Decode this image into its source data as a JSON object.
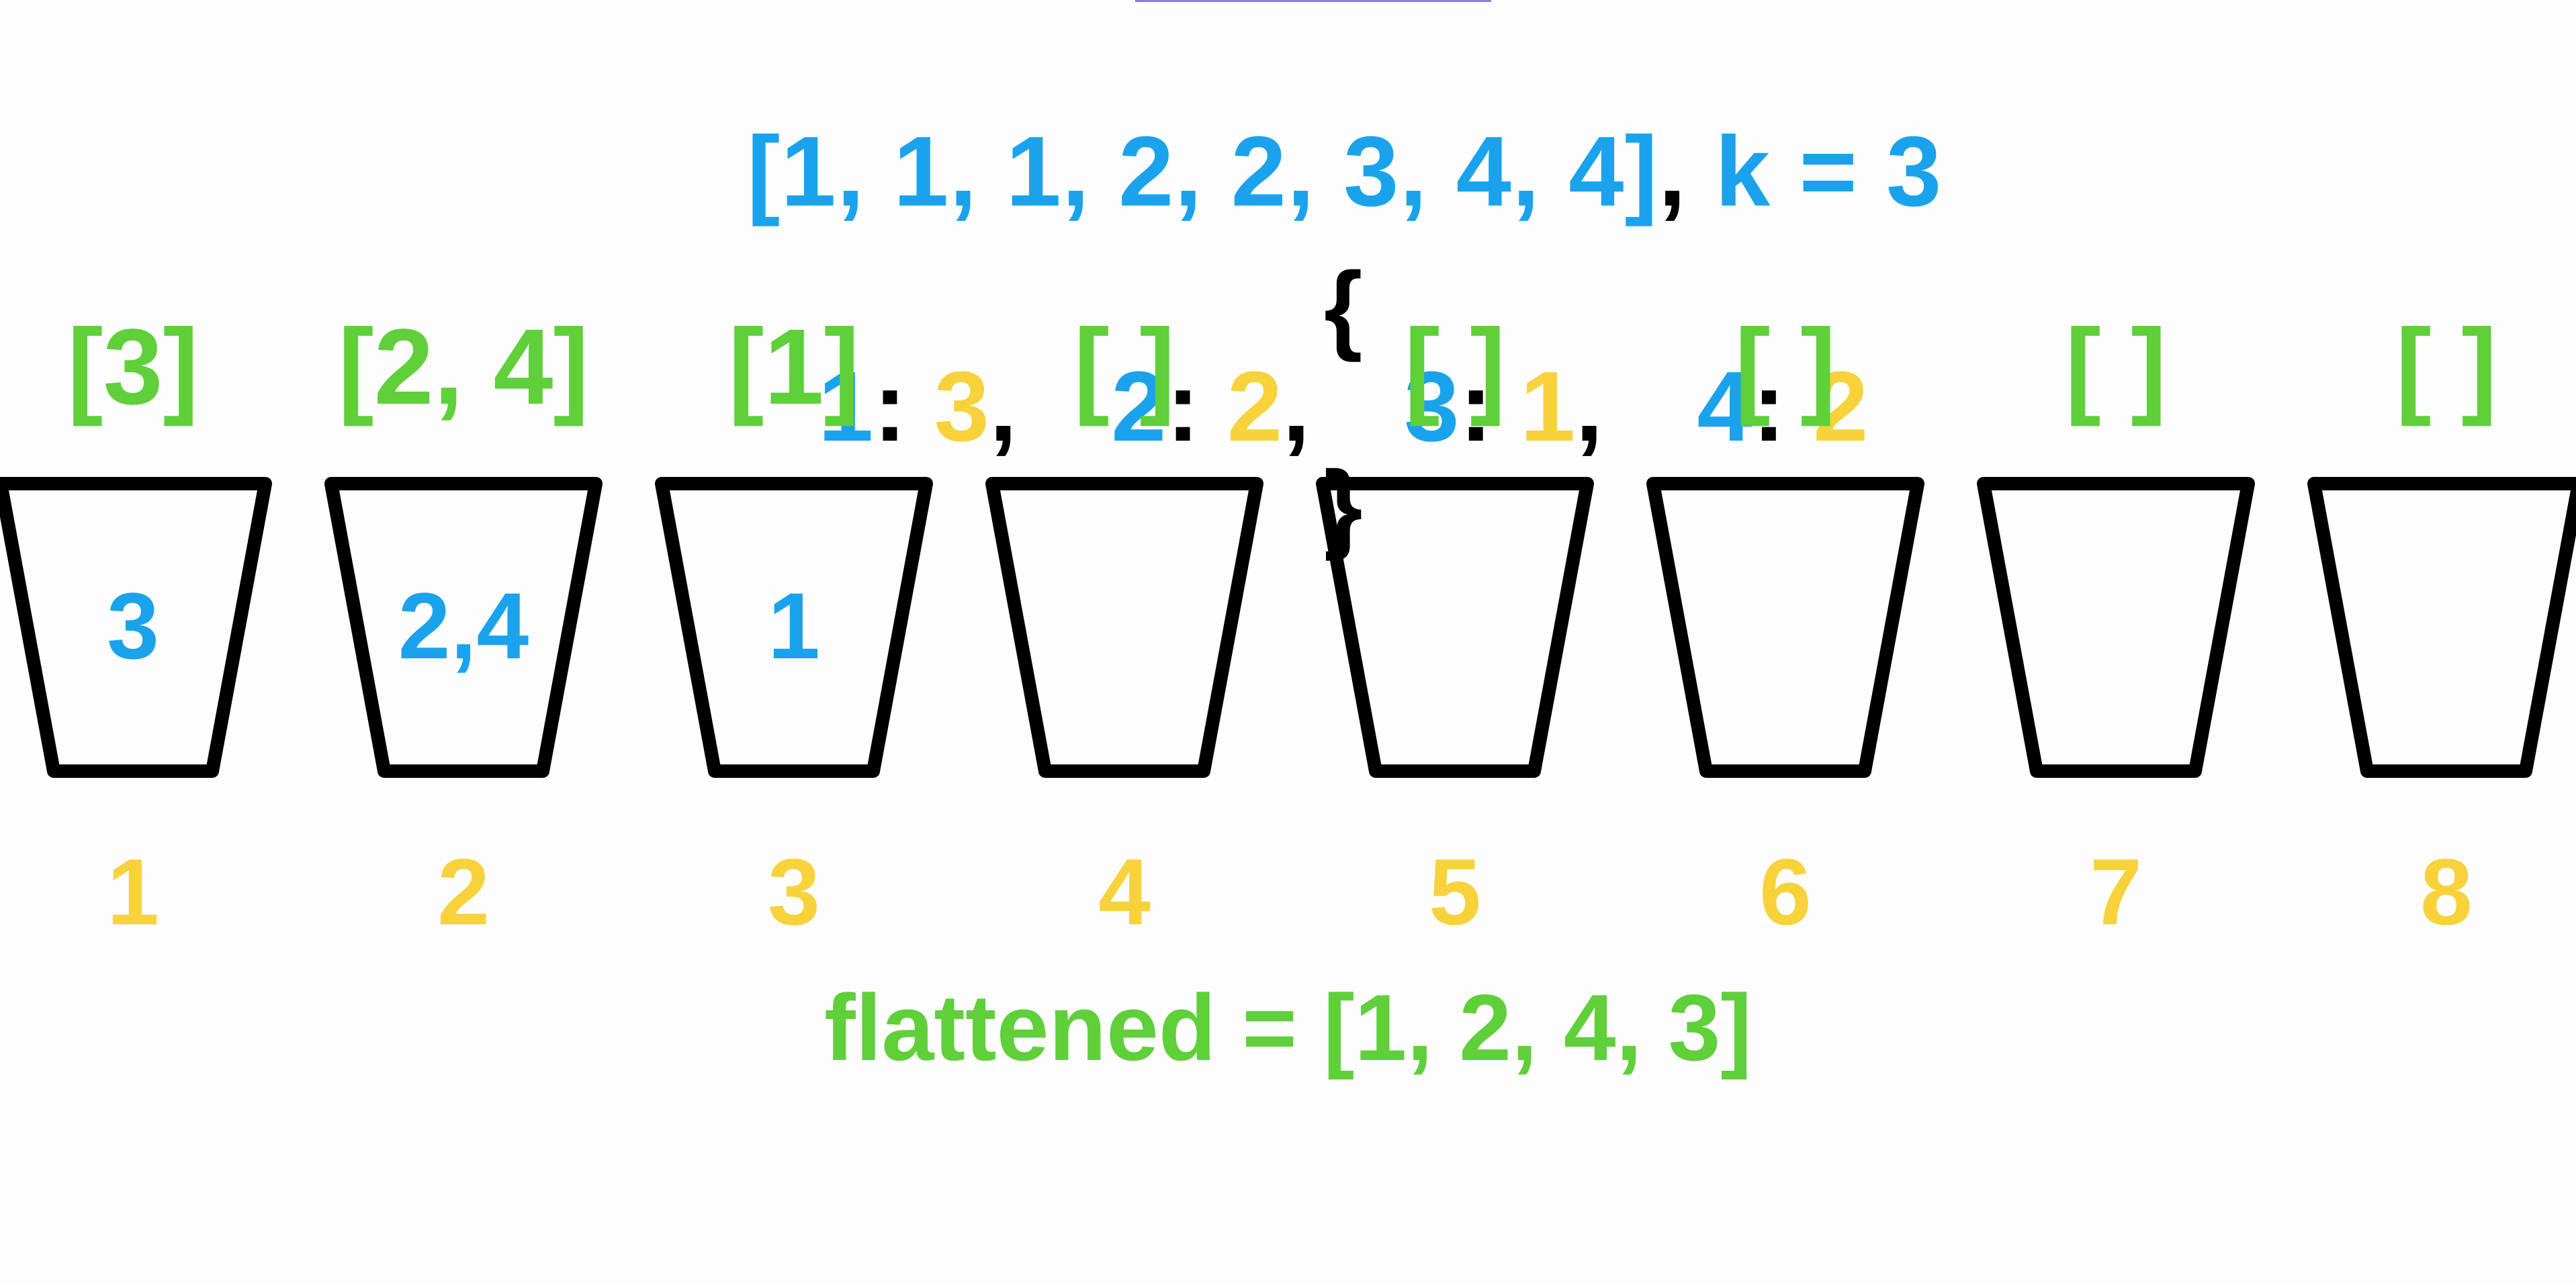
{
  "colors": {
    "blue": "#1aa3ec",
    "yellow": "#f7d23b",
    "green": "#5fcf3a",
    "black": "#000000",
    "accent": "#8a7fd6"
  },
  "input": {
    "array_text": "[1, 1, 1, 2, 2, 3, 4, 4]",
    "separator": ", ",
    "k_text": "k = 3"
  },
  "counts": {
    "open_brace": "{",
    "close_brace": "}",
    "entries": [
      {
        "key": "1",
        "colon": ": ",
        "value": "3",
        "comma": ","
      },
      {
        "key": "2",
        "colon": ": ",
        "value": "2",
        "comma": ","
      },
      {
        "key": "3",
        "colon": ": ",
        "value": "1",
        "comma": ","
      },
      {
        "key": "4",
        "colon": ": ",
        "value": "2",
        "comma": ""
      }
    ]
  },
  "buckets": [
    {
      "list_label": "[3]",
      "content": "3",
      "number": "1"
    },
    {
      "list_label": "[2, 4]",
      "content": "2,4",
      "number": "2"
    },
    {
      "list_label": "[1]",
      "content": "1",
      "number": "3"
    },
    {
      "list_label": "[ ]",
      "content": "",
      "number": "4"
    },
    {
      "list_label": "[ ]",
      "content": "",
      "number": "5"
    },
    {
      "list_label": "[ ]",
      "content": "",
      "number": "6"
    },
    {
      "list_label": "[ ]",
      "content": "",
      "number": "7"
    },
    {
      "list_label": "[ ]",
      "content": "",
      "number": "8"
    }
  ],
  "flattened": {
    "text": "flattened = [1, 2, 4, 3]"
  }
}
